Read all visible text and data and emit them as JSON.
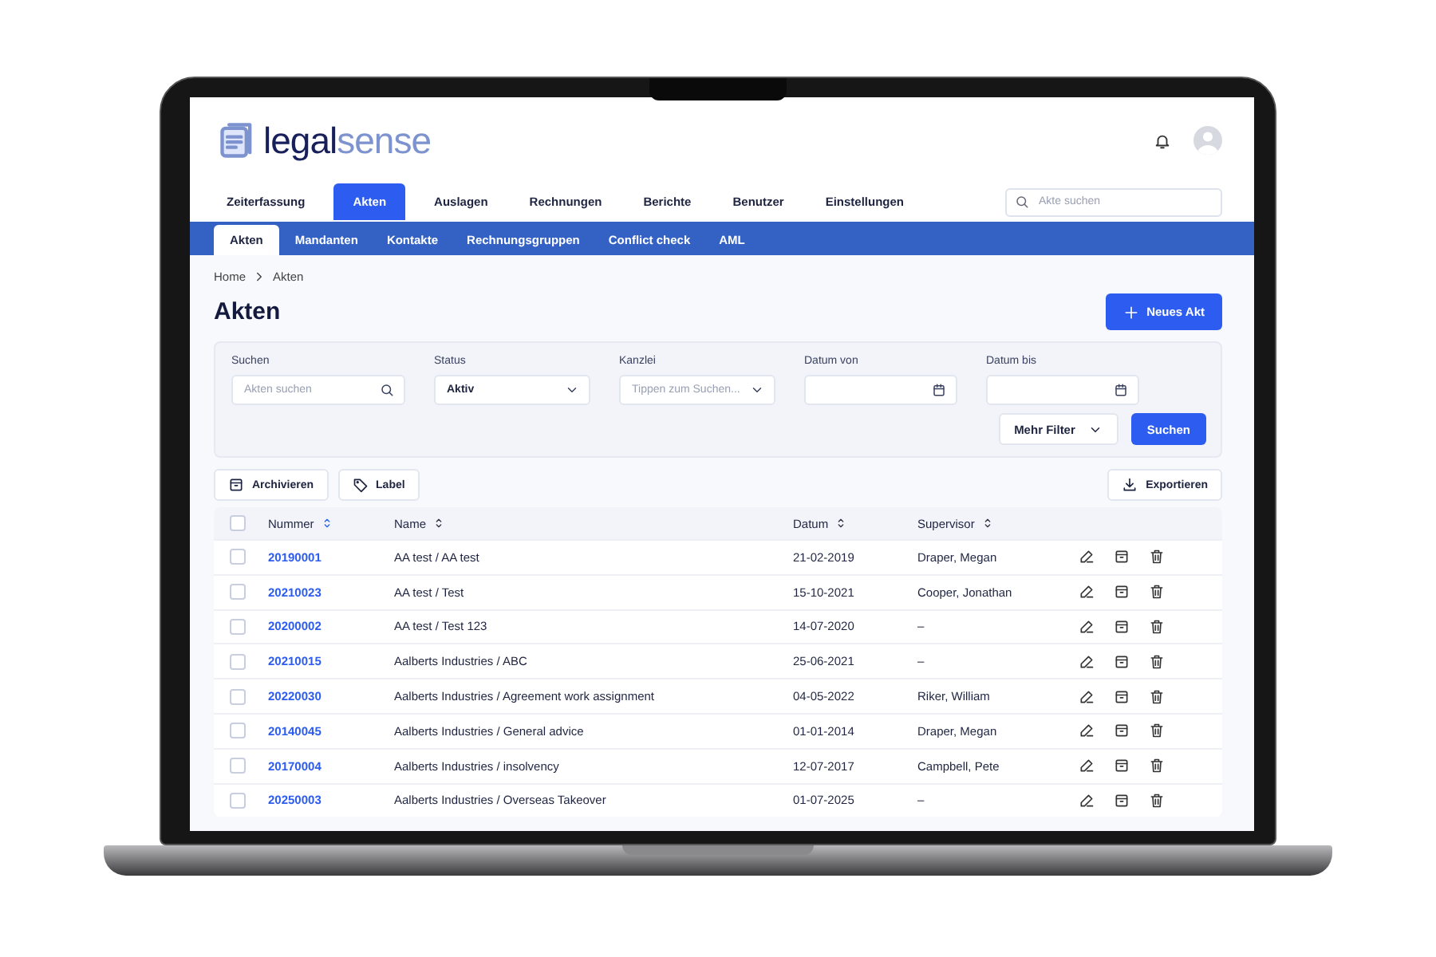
{
  "logo": {
    "first": "legal",
    "second": "sense"
  },
  "nav": {
    "tabs": [
      {
        "label": "Zeiterfassung",
        "selected": false
      },
      {
        "label": "Akten",
        "selected": true
      },
      {
        "label": "Auslagen",
        "selected": false
      },
      {
        "label": "Rechnungen",
        "selected": false
      },
      {
        "label": "Berichte",
        "selected": false
      },
      {
        "label": "Benutzer",
        "selected": false
      },
      {
        "label": "Einstellungen",
        "selected": false
      }
    ],
    "search": {
      "placeholder": "Akte suchen"
    }
  },
  "subnav": {
    "tabs": [
      {
        "label": "Akten",
        "selected": true
      },
      {
        "label": "Mandanten",
        "selected": false
      },
      {
        "label": "Kontakte",
        "selected": false
      },
      {
        "label": "Rechnungsgruppen",
        "selected": false
      },
      {
        "label": "Conflict check",
        "selected": false
      },
      {
        "label": "AML",
        "selected": false
      }
    ]
  },
  "breadcrumb": [
    "Home",
    "Akten"
  ],
  "page_title": "Akten",
  "new_button": "Neues Akt",
  "filters": {
    "fields": [
      {
        "label": "Suchen",
        "kind": "search",
        "placeholder": "Akten suchen"
      },
      {
        "label": "Status",
        "kind": "select",
        "value": "Aktiv"
      },
      {
        "label": "Kanzlei",
        "kind": "select",
        "placeholder": "Tippen zum Suchen..."
      },
      {
        "label": "Datum von",
        "kind": "date"
      },
      {
        "label": "Datum bis",
        "kind": "date"
      }
    ],
    "more_button": "Mehr Filter",
    "search_button": "Suchen"
  },
  "toolbar": {
    "archive_button": "Archivieren",
    "label_button": "Label",
    "export_button": "Exportieren"
  },
  "table": {
    "all_selected": false,
    "columns": [
      "Nummer",
      "Name",
      "Datum",
      "Supervisor"
    ],
    "rows": [
      {
        "selected": false,
        "number": "20190001",
        "name": "AA test / AA test",
        "date": "21-02-2019",
        "supervisor": "Draper, Megan"
      },
      {
        "selected": false,
        "number": "20210023",
        "name": "AA test / Test",
        "date": "15-10-2021",
        "supervisor": "Cooper, Jonathan"
      },
      {
        "selected": false,
        "number": "20200002",
        "name": "AA test / Test 123",
        "date": "14-07-2020",
        "supervisor": "–"
      },
      {
        "selected": false,
        "number": "20210015",
        "name": "Aalberts Industries / ABC",
        "date": "25-06-2021",
        "supervisor": "–"
      },
      {
        "selected": false,
        "number": "20220030",
        "name": "Aalberts Industries / Agreement work assignment",
        "date": "04-05-2022",
        "supervisor": "Riker, William"
      },
      {
        "selected": false,
        "number": "20140045",
        "name": "Aalberts Industries / General advice",
        "date": "01-01-2014",
        "supervisor": "Draper, Megan"
      },
      {
        "selected": false,
        "number": "20170004",
        "name": "Aalberts Industries / insolvency",
        "date": "12-07-2017",
        "supervisor": "Campbell, Pete"
      },
      {
        "selected": false,
        "number": "20250003",
        "name": "Aalberts Industries / Overseas Takeover",
        "date": "01-07-2025",
        "supervisor": "–"
      }
    ]
  }
}
